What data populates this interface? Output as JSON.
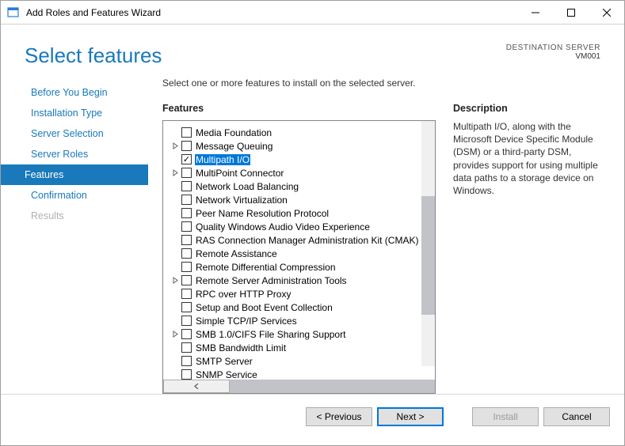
{
  "window": {
    "title": "Add Roles and Features Wizard"
  },
  "header": {
    "page_title": "Select features",
    "destination_label": "DESTINATION SERVER",
    "destination_name": "VM001"
  },
  "steps": [
    {
      "label": "Before You Begin",
      "state": "normal"
    },
    {
      "label": "Installation Type",
      "state": "normal"
    },
    {
      "label": "Server Selection",
      "state": "normal"
    },
    {
      "label": "Server Roles",
      "state": "normal"
    },
    {
      "label": "Features",
      "state": "selected"
    },
    {
      "label": "Confirmation",
      "state": "normal"
    },
    {
      "label": "Results",
      "state": "disabled"
    }
  ],
  "content": {
    "instruction": "Select one or more features to install on the selected server.",
    "features_heading": "Features",
    "description_heading": "Description",
    "description_text": "Multipath I/O, along with the Microsoft Device Specific Module (DSM) or a third-party DSM, provides support for using multiple data paths to a storage device on Windows.",
    "features": [
      {
        "label": "Media Foundation",
        "checked": false,
        "expandable": false,
        "selected": false
      },
      {
        "label": "Message Queuing",
        "checked": false,
        "expandable": true,
        "selected": false
      },
      {
        "label": "Multipath I/O",
        "checked": true,
        "expandable": false,
        "selected": true
      },
      {
        "label": "MultiPoint Connector",
        "checked": false,
        "expandable": true,
        "selected": false
      },
      {
        "label": "Network Load Balancing",
        "checked": false,
        "expandable": false,
        "selected": false
      },
      {
        "label": "Network Virtualization",
        "checked": false,
        "expandable": false,
        "selected": false
      },
      {
        "label": "Peer Name Resolution Protocol",
        "checked": false,
        "expandable": false,
        "selected": false
      },
      {
        "label": "Quality Windows Audio Video Experience",
        "checked": false,
        "expandable": false,
        "selected": false
      },
      {
        "label": "RAS Connection Manager Administration Kit (CMAK)",
        "checked": false,
        "expandable": false,
        "selected": false
      },
      {
        "label": "Remote Assistance",
        "checked": false,
        "expandable": false,
        "selected": false
      },
      {
        "label": "Remote Differential Compression",
        "checked": false,
        "expandable": false,
        "selected": false
      },
      {
        "label": "Remote Server Administration Tools",
        "checked": false,
        "expandable": true,
        "selected": false
      },
      {
        "label": "RPC over HTTP Proxy",
        "checked": false,
        "expandable": false,
        "selected": false
      },
      {
        "label": "Setup and Boot Event Collection",
        "checked": false,
        "expandable": false,
        "selected": false
      },
      {
        "label": "Simple TCP/IP Services",
        "checked": false,
        "expandable": false,
        "selected": false
      },
      {
        "label": "SMB 1.0/CIFS File Sharing Support",
        "checked": false,
        "expandable": true,
        "selected": false
      },
      {
        "label": "SMB Bandwidth Limit",
        "checked": false,
        "expandable": false,
        "selected": false
      },
      {
        "label": "SMTP Server",
        "checked": false,
        "expandable": false,
        "selected": false
      },
      {
        "label": "SNMP Service",
        "checked": false,
        "expandable": false,
        "selected": false
      }
    ]
  },
  "footer": {
    "previous": "< Previous",
    "next": "Next >",
    "install": "Install",
    "cancel": "Cancel"
  }
}
